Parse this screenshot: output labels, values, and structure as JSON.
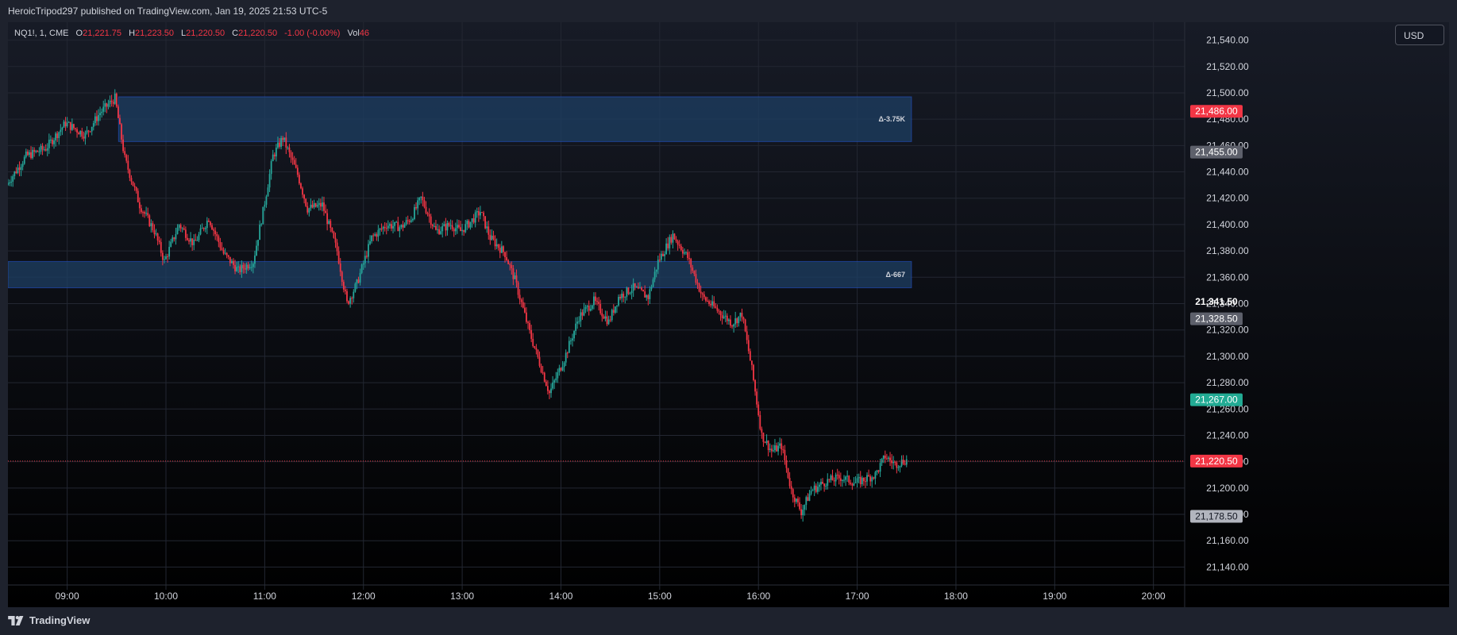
{
  "header": {
    "published_text": "HeroicTripod297 published on TradingView.com, Jan 19, 2025 21:53 UTC-5"
  },
  "legend": {
    "symbol": "NQ1!, 1, CME",
    "open_label": "O",
    "open": "21,221.75",
    "high_label": "H",
    "high": "21,223.50",
    "low_label": "L",
    "low": "21,220.50",
    "close_label": "C",
    "close": "21,220.50",
    "change": "-1.00 (-0.00%)",
    "vol_label": "Vol",
    "vol": "46"
  },
  "currency_button": "USD",
  "footer": {
    "brand": "TradingView",
    "logo_icon": "tradingview-logo-icon"
  },
  "colors": {
    "background": "#131722",
    "up": "#26a69a",
    "down": "#f23645",
    "zone_fill": "#1e3f63",
    "zone_border": "#2962ff"
  },
  "chart_data": {
    "type": "candlestick",
    "x_ticks": [
      "09:00",
      "10:00",
      "11:00",
      "12:00",
      "13:00",
      "14:00",
      "15:00",
      "16:00",
      "17:00",
      "18:00",
      "19:00",
      "20:00"
    ],
    "y_ticks": [
      "21,540.00",
      "21,520.00",
      "21,500.00",
      "21,480.00",
      "21,460.00",
      "21,440.00",
      "21,420.00",
      "21,400.00",
      "21,380.00",
      "21,360.00",
      "21,340.00",
      "21,320.00",
      "21,300.00",
      "21,280.00",
      "21,260.00",
      "21,240.00",
      "21,220.00",
      "21,200.00",
      "21,180.00",
      "21,160.00",
      "21,140.00"
    ],
    "ylim": [
      21130,
      21550
    ],
    "x_range_hours": [
      8.4,
      20.3
    ],
    "price_path": [
      [
        8.4,
        21430
      ],
      [
        8.6,
        21452
      ],
      [
        8.8,
        21458
      ],
      [
        9.0,
        21477
      ],
      [
        9.2,
        21468
      ],
      [
        9.35,
        21485
      ],
      [
        9.5,
        21496
      ],
      [
        9.6,
        21450
      ],
      [
        9.75,
        21415
      ],
      [
        9.9,
        21395
      ],
      [
        10.0,
        21372
      ],
      [
        10.15,
        21400
      ],
      [
        10.3,
        21385
      ],
      [
        10.45,
        21405
      ],
      [
        10.6,
        21378
      ],
      [
        10.75,
        21365
      ],
      [
        10.9,
        21372
      ],
      [
        11.0,
        21410
      ],
      [
        11.1,
        21452
      ],
      [
        11.2,
        21466
      ],
      [
        11.35,
        21438
      ],
      [
        11.45,
        21412
      ],
      [
        11.6,
        21415
      ],
      [
        11.75,
        21380
      ],
      [
        11.85,
        21340
      ],
      [
        11.95,
        21355
      ],
      [
        12.1,
        21390
      ],
      [
        12.25,
        21400
      ],
      [
        12.4,
        21398
      ],
      [
        12.5,
        21405
      ],
      [
        12.6,
        21420
      ],
      [
        12.75,
        21395
      ],
      [
        12.9,
        21400
      ],
      [
        13.0,
        21395
      ],
      [
        13.1,
        21402
      ],
      [
        13.2,
        21410
      ],
      [
        13.3,
        21390
      ],
      [
        13.45,
        21378
      ],
      [
        13.55,
        21358
      ],
      [
        13.7,
        21318
      ],
      [
        13.8,
        21295
      ],
      [
        13.9,
        21272
      ],
      [
        14.05,
        21298
      ],
      [
        14.2,
        21330
      ],
      [
        14.35,
        21342
      ],
      [
        14.5,
        21326
      ],
      [
        14.6,
        21345
      ],
      [
        14.75,
        21352
      ],
      [
        14.9,
        21345
      ],
      [
        15.0,
        21372
      ],
      [
        15.15,
        21392
      ],
      [
        15.3,
        21375
      ],
      [
        15.45,
        21345
      ],
      [
        15.6,
        21335
      ],
      [
        15.75,
        21325
      ],
      [
        15.85,
        21332
      ],
      [
        15.95,
        21290
      ],
      [
        16.05,
        21240
      ],
      [
        16.15,
        21228
      ],
      [
        16.25,
        21232
      ],
      [
        16.35,
        21198
      ],
      [
        16.45,
        21182
      ],
      [
        16.55,
        21198
      ],
      [
        16.7,
        21205
      ],
      [
        16.85,
        21208
      ],
      [
        17.0,
        21204
      ],
      [
        17.1,
        21207
      ],
      [
        17.2,
        21210
      ],
      [
        17.3,
        21224
      ],
      [
        17.4,
        21218
      ],
      [
        17.5,
        21221
      ]
    ],
    "zones": [
      {
        "label": "Δ-3.75K",
        "top": 21497,
        "bottom": 21463,
        "start": 9.52,
        "end": 17.55
      },
      {
        "label": "Δ-667",
        "top": 21372,
        "bottom": 21352,
        "start": 8.4,
        "end": 17.55
      }
    ],
    "last_price": 21220.5,
    "price_badges": [
      {
        "label": "21,486.00",
        "value": 21486,
        "bg": "#f23645",
        "fg": "#ffffff"
      },
      {
        "label": "21,455.00",
        "value": 21455,
        "bg": "#5d606b",
        "fg": "#ffffff"
      },
      {
        "label": "21,341.50",
        "value": 21341.5,
        "bg": "none",
        "fg": "#ffffff"
      },
      {
        "label": "21,328.50",
        "value": 21328.5,
        "bg": "#5d606b",
        "fg": "#ffffff"
      },
      {
        "label": "21,267.00",
        "value": 21267,
        "bg": "#22ab94",
        "fg": "#ffffff"
      },
      {
        "label": "21,220.50",
        "value": 21220.5,
        "bg": "#f23645",
        "fg": "#ffffff"
      },
      {
        "label": "21,178.50",
        "value": 21178.5,
        "bg": "#b2b5be",
        "fg": "#131722"
      }
    ]
  }
}
